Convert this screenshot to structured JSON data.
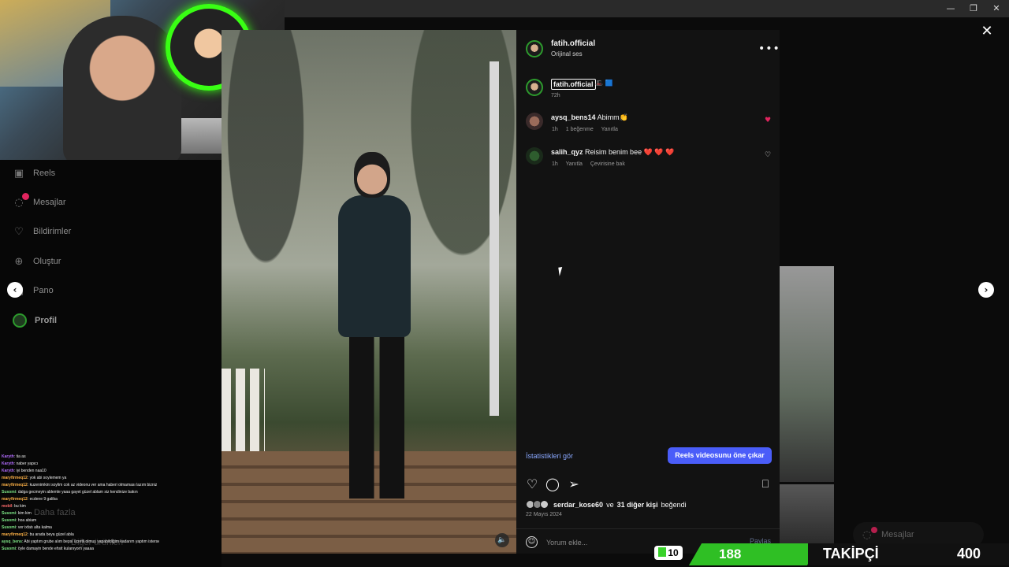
{
  "window": {
    "minimize": "—",
    "maximize": "❐",
    "close": "✕"
  },
  "sidebar": {
    "items": [
      {
        "label": "Reels",
        "icon": "reels-icon"
      },
      {
        "label": "Mesajlar",
        "icon": "messenger-icon"
      },
      {
        "label": "Bildirimler",
        "icon": "heart-icon"
      },
      {
        "label": "Oluştur",
        "icon": "plus-icon"
      },
      {
        "label": "Pano",
        "icon": "dashboard-icon"
      },
      {
        "label": "Profil",
        "icon": "profile-avatar"
      }
    ],
    "faded": [
      "Daha fazla",
      "Diğer ürünleri"
    ]
  },
  "chat": [
    {
      "user": "Karyth",
      "text": "tia as",
      "color": "#b36cff"
    },
    {
      "user": "Karyth",
      "text": "naber yapıcı",
      "color": "#b36cff"
    },
    {
      "user": "Karyth",
      "text": "iyi benden naa10",
      "color": "#b36cff"
    },
    {
      "user": "maryfirmeq12",
      "text": "yok abi soylemem ya",
      "color": "#ffb347"
    },
    {
      "user": "maryfirmeq12",
      "text": "kuzenimkini soylim cok az videonu ver ama haberi olmaması lazım bizniz",
      "color": "#ffb347"
    },
    {
      "user": "Susomi",
      "text": "dalga gecmeyin ablemle yaaa gayet güzel ablam siz kendinize bakın",
      "color": "#7ee787"
    },
    {
      "user": "maryfirmeq12",
      "text": "ecdene 9 galiba",
      "color": "#ffb347"
    },
    {
      "user": "mobil",
      "text": "bu kim",
      "color": "#ff6b6b"
    },
    {
      "user": "Susomi",
      "text": "kim kim",
      "color": "#7ee787"
    },
    {
      "user": "Susomi",
      "text": "hoa abiam",
      "color": "#7ee787"
    },
    {
      "user": "Susomi",
      "text": "ver ixfatı alta kalma",
      "color": "#7ee787"
    },
    {
      "user": "maryfirmeq12",
      "text": "bu arada beya güzel abla",
      "color": "#ffb347"
    },
    {
      "user": "aysq_bens",
      "text": "Abi yaptım grube alım bepsi ücretli olmuş yapabildiğim kadarım yaptım isterseni para verip yapabilirim 😅",
      "color": "#7ee787"
    },
    {
      "user": "Susomi",
      "text": "öyle damayin bende ehsit kulanıyorn yaaaa",
      "color": "#7ee787"
    }
  ],
  "post": {
    "author": "fatih.official",
    "audio": "Orijinal ses",
    "more": "•••",
    "caption_user": "fatih.official",
    "caption_emoji": "🎩 🟦",
    "caption_time": "72h",
    "comments": [
      {
        "user": "aysq_bens14",
        "text": "Abimm👏",
        "time": "1h",
        "likes": "1 beğenme",
        "reply": "Yanıtla",
        "translate": "",
        "liked": true
      },
      {
        "user": "salih_qyz",
        "text": "Reisim benim bee ❤️ ❤️ ❤️",
        "time": "1h",
        "likes": "",
        "reply": "Yanıtla",
        "translate": "Çevirisine bak",
        "liked": false
      }
    ],
    "stats_link": "İstatistikleri gör",
    "boost_button": "Reels videosunu öne çıkar",
    "liked_by_user": "serdar_kose60",
    "liked_by_mid": "ve",
    "liked_by_others": "31 diğer kişi",
    "liked_by_end": "beğendi",
    "date": "22 Mayıs 2024",
    "comment_placeholder": "Yorum ekle...",
    "post_button": "Paylaş"
  },
  "messages_pill": {
    "label": "Mesajlar"
  },
  "follower_bar": {
    "badge": "10",
    "count": "188",
    "label": "TAKİPÇİ",
    "goal": "400"
  },
  "colors": {
    "accent": "#4a5df9",
    "follow_green": "#2fbf24",
    "like_red": "#e0245e"
  }
}
